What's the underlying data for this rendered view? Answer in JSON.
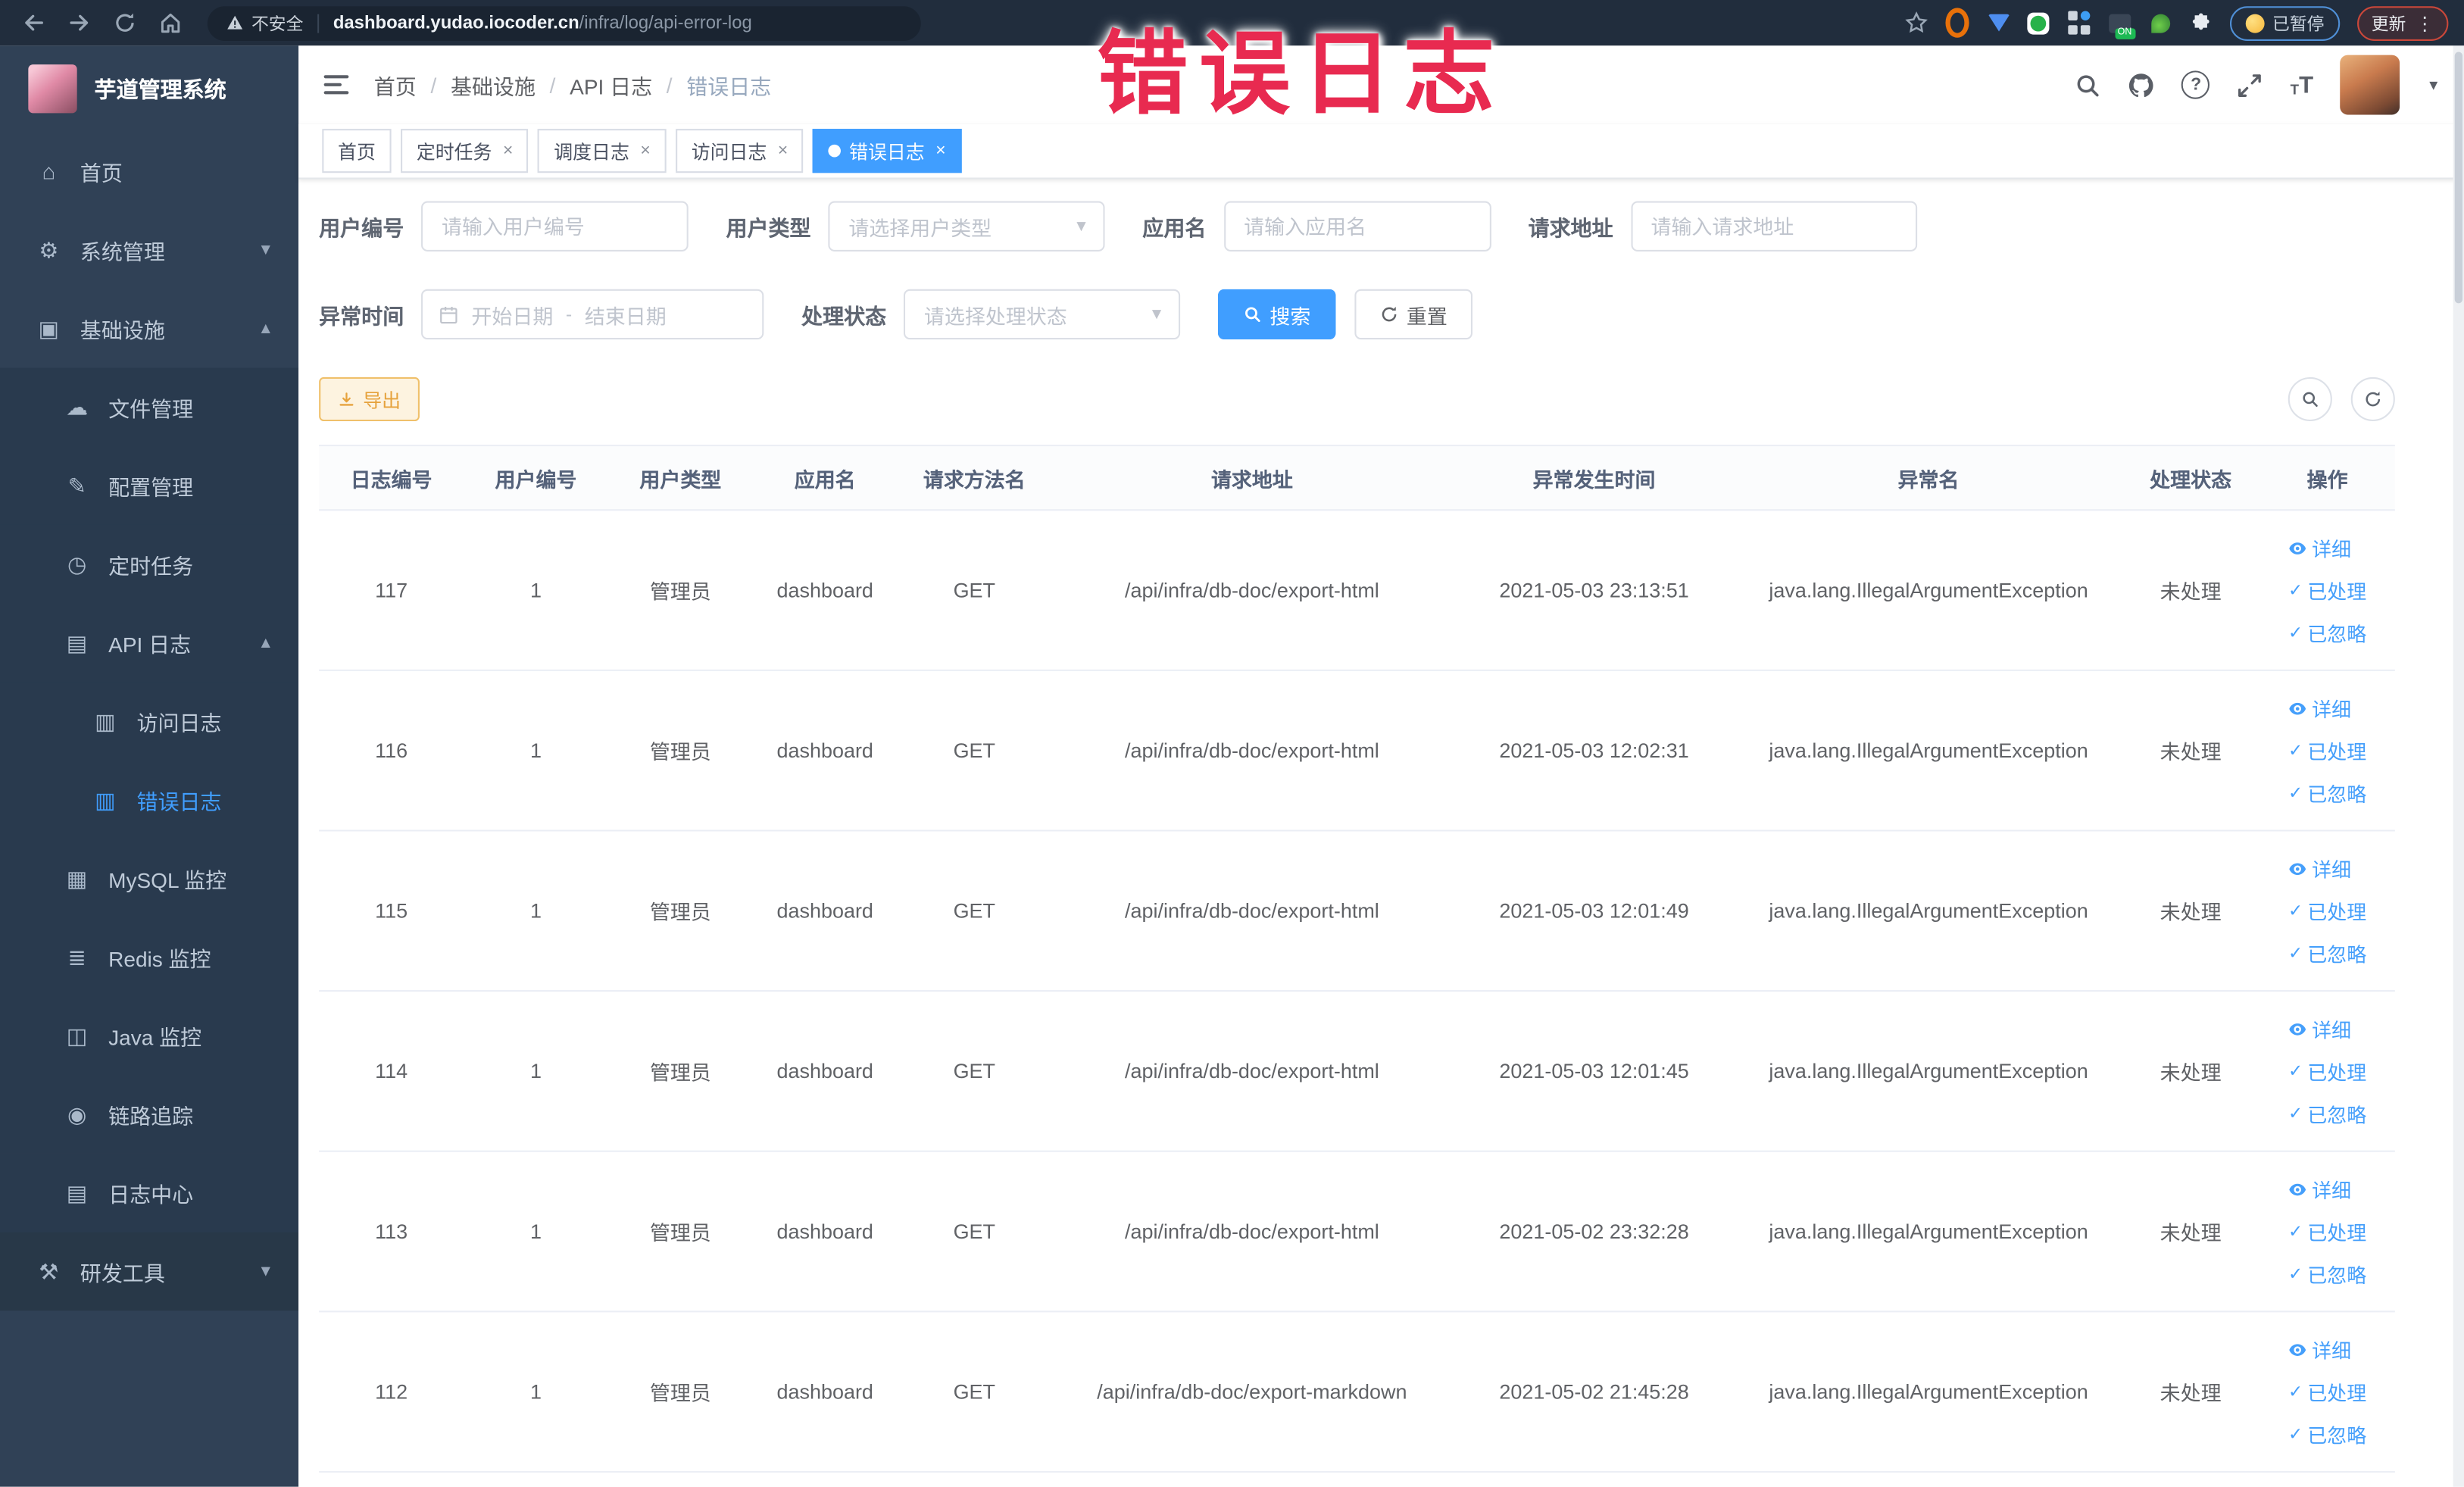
{
  "watermark": "错误日志",
  "browser": {
    "security_label": "不安全",
    "url_host": "dashboard.yudao.iocoder.cn",
    "url_path": "/infra/log/api-error-log",
    "paused_badge": "已暂停",
    "update_badge": "更新"
  },
  "sidebar": {
    "app_title": "芋道管理系统",
    "items": [
      {
        "key": "home",
        "label": "首页",
        "icon": "home",
        "level": 1
      },
      {
        "key": "system",
        "label": "系统管理",
        "icon": "gear",
        "level": 1,
        "chevron": "down"
      },
      {
        "key": "infra",
        "label": "基础设施",
        "icon": "monitor",
        "level": 1,
        "chevron": "up"
      },
      {
        "key": "file-manage",
        "label": "文件管理",
        "icon": "cloud",
        "level": 2,
        "nested": true
      },
      {
        "key": "config-manage",
        "label": "配置管理",
        "icon": "edit",
        "level": 2,
        "nested": true
      },
      {
        "key": "scheduled-job",
        "label": "定时任务",
        "icon": "clock",
        "level": 2,
        "nested": true
      },
      {
        "key": "api-log",
        "label": "API 日志",
        "icon": "log",
        "level": 2,
        "chevron": "up",
        "nested": true
      },
      {
        "key": "access-log",
        "label": "访问日志",
        "icon": "doc",
        "level": 3,
        "nested": true
      },
      {
        "key": "error-log",
        "label": "错误日志",
        "icon": "doc",
        "level": 3,
        "nested": true,
        "active": true
      },
      {
        "key": "mysql-monitor",
        "label": "MySQL 监控",
        "icon": "db",
        "level": 2,
        "nested": true
      },
      {
        "key": "redis-monitor",
        "label": "Redis 监控",
        "icon": "layers",
        "level": 2,
        "nested": true
      },
      {
        "key": "java-monitor",
        "label": "Java 监控",
        "icon": "screen",
        "level": 2,
        "nested": true
      },
      {
        "key": "trace",
        "label": "链路追踪",
        "icon": "eye",
        "level": 2,
        "nested": true
      },
      {
        "key": "log-center",
        "label": "日志中心",
        "icon": "log",
        "level": 2,
        "nested": true
      },
      {
        "key": "dev-tools",
        "label": "研发工具",
        "icon": "tools",
        "level": 1,
        "chevron": "down",
        "darker": true
      }
    ]
  },
  "header": {
    "breadcrumbs": [
      "首页",
      "基础设施",
      "API 日志",
      "错误日志"
    ]
  },
  "tags": [
    {
      "label": "首页",
      "closable": false,
      "active": false
    },
    {
      "label": "定时任务",
      "closable": true,
      "active": false
    },
    {
      "label": "调度日志",
      "closable": true,
      "active": false
    },
    {
      "label": "访问日志",
      "closable": true,
      "active": false
    },
    {
      "label": "错误日志",
      "closable": true,
      "active": true
    }
  ],
  "filters": {
    "user_id_label": "用户编号",
    "user_id_placeholder": "请输入用户编号",
    "user_type_label": "用户类型",
    "user_type_placeholder": "请选择用户类型",
    "app_name_label": "应用名",
    "app_name_placeholder": "请输入应用名",
    "request_url_label": "请求地址",
    "request_url_placeholder": "请输入请求地址",
    "exception_time_label": "异常时间",
    "date_start_placeholder": "开始日期",
    "date_separator": "-",
    "date_end_placeholder": "结束日期",
    "process_status_label": "处理状态",
    "process_status_placeholder": "请选择处理状态",
    "search_label": "搜索",
    "reset_label": "重置"
  },
  "toolbar": {
    "export_label": "导出"
  },
  "table": {
    "columns": [
      "日志编号",
      "用户编号",
      "用户类型",
      "应用名",
      "请求方法名",
      "请求地址",
      "异常发生时间",
      "异常名",
      "处理状态",
      "操作"
    ],
    "row_actions": [
      "详细",
      "已处理",
      "已忽略"
    ],
    "rows": [
      {
        "id": "117",
        "user_id": "1",
        "user_type": "管理员",
        "app": "dashboard",
        "method": "GET",
        "url": "/api/infra/db-doc/export-html",
        "time": "2021-05-03 23:13:51",
        "exception": "java.lang.IllegalArgumentException",
        "status": "未处理"
      },
      {
        "id": "116",
        "user_id": "1",
        "user_type": "管理员",
        "app": "dashboard",
        "method": "GET",
        "url": "/api/infra/db-doc/export-html",
        "time": "2021-05-03 12:02:31",
        "exception": "java.lang.IllegalArgumentException",
        "status": "未处理"
      },
      {
        "id": "115",
        "user_id": "1",
        "user_type": "管理员",
        "app": "dashboard",
        "method": "GET",
        "url": "/api/infra/db-doc/export-html",
        "time": "2021-05-03 12:01:49",
        "exception": "java.lang.IllegalArgumentException",
        "status": "未处理"
      },
      {
        "id": "114",
        "user_id": "1",
        "user_type": "管理员",
        "app": "dashboard",
        "method": "GET",
        "url": "/api/infra/db-doc/export-html",
        "time": "2021-05-03 12:01:45",
        "exception": "java.lang.IllegalArgumentException",
        "status": "未处理"
      },
      {
        "id": "113",
        "user_id": "1",
        "user_type": "管理员",
        "app": "dashboard",
        "method": "GET",
        "url": "/api/infra/db-doc/export-html",
        "time": "2021-05-02 23:32:28",
        "exception": "java.lang.IllegalArgumentException",
        "status": "未处理"
      },
      {
        "id": "112",
        "user_id": "1",
        "user_type": "管理员",
        "app": "dashboard",
        "method": "GET",
        "url": "/api/infra/db-doc/export-markdown",
        "time": "2021-05-02 21:45:28",
        "exception": "java.lang.IllegalArgumentException",
        "status": "未处理"
      }
    ]
  },
  "colors": {
    "accent": "#409EFF",
    "warning_orange": "#E6A23C",
    "sidebar_bg": "#304156",
    "tag_active": "#409EFF",
    "watermark_red": "#E82A50",
    "chrome_bar": "#212D3D"
  }
}
